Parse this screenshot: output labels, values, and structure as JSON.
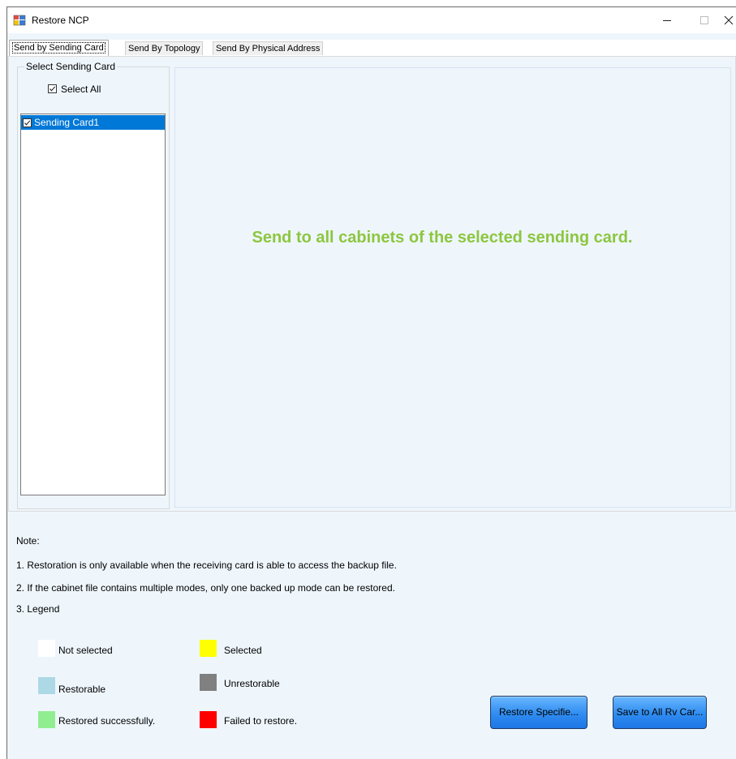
{
  "window": {
    "title": "Restore NCP",
    "minimize_glyph": "–",
    "maximize_glyph": "□",
    "close_glyph": "✕",
    "icon": "app-icon"
  },
  "tabs": [
    {
      "label": "Send by Sending Card",
      "active": true
    },
    {
      "label": "Send By Topology",
      "active": false
    },
    {
      "label": "Send By Physical Address",
      "active": false
    }
  ],
  "sending_card_group": {
    "title": "Select Sending Card",
    "select_all_label": "Select All",
    "select_all_checked": true,
    "items": [
      {
        "label": "Sending Card1",
        "checked": true,
        "selected": true
      }
    ]
  },
  "main": {
    "message": "Send to all cabinets of the selected sending card.",
    "message_color": "#8dc63f"
  },
  "notes": {
    "heading": "Note:",
    "lines": [
      "1. Restoration is only available when the receiving card is able to access the backup file.",
      "2. If the cabinet file contains multiple modes, only one backed up mode can be restored.",
      "3. Legend"
    ]
  },
  "legend": [
    {
      "label": "Not selected",
      "color": "#ffffff"
    },
    {
      "label": "Selected",
      "color": "#ffff00"
    },
    {
      "label": "Restorable",
      "color": "#add8e6"
    },
    {
      "label": "Unrestorable",
      "color": "#808080"
    },
    {
      "label": "Restored successfully.",
      "color": "#90ee90"
    },
    {
      "label": "Failed to restore.",
      "color": "#ff0000"
    }
  ],
  "buttons": {
    "restore_specified": "Restore Specifie...",
    "save_to_all": "Save to All Rv Car..."
  }
}
